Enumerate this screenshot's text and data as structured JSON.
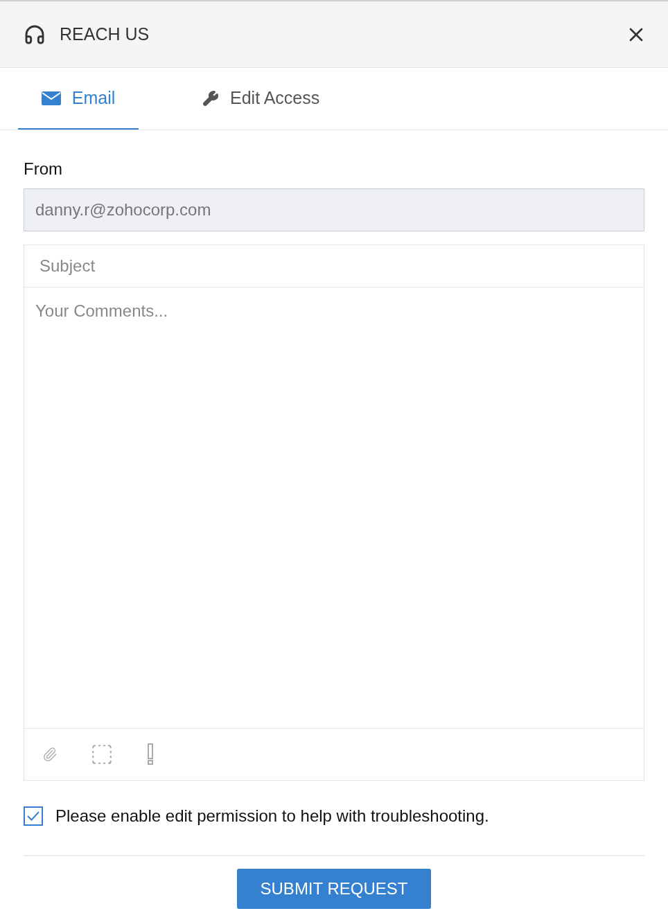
{
  "header": {
    "title": "REACH US"
  },
  "tabs": [
    {
      "kind": "email",
      "label": "Email",
      "selected": true
    },
    {
      "kind": "edit",
      "label": "Edit Access",
      "selected": false
    }
  ],
  "from": {
    "label": "From",
    "value": "danny.r@zohocorp.com"
  },
  "subject": {
    "placeholder": "Subject"
  },
  "comments": {
    "placeholder": "Your Comments..."
  },
  "permission": {
    "label": "Please enable edit permission to help with troubleshooting.",
    "checked": true
  },
  "submit": "SUBMIT REQUEST"
}
